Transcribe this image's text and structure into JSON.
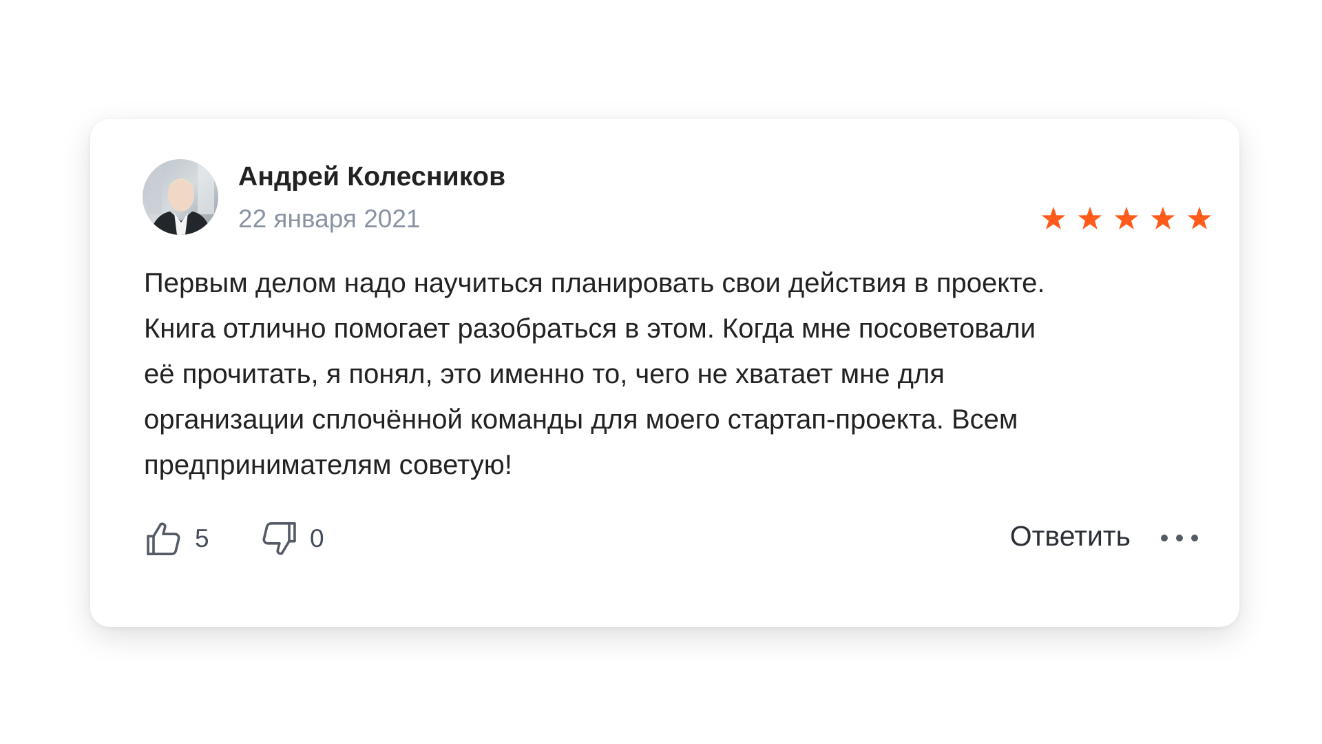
{
  "review": {
    "author": "Андрей Колесников",
    "date": "22 января 2021",
    "rating": 5,
    "rating_max": 5,
    "star_color": "#ff5b1a",
    "text_lines": [
      "Первым делом надо научиться планировать свои действия в проекте.",
      "Книга отлично помогает разобраться в этом. Когда мне посоветовали",
      "её прочитать, я понял, это именно то, чего не хватает мне для",
      "организации сплочённой команды для моего стартап-проекта. Всем",
      "предпринимателям советую!"
    ]
  },
  "actions": {
    "likes": "5",
    "dislikes": "0",
    "reply_label": "Ответить",
    "more_icon": "more-horizontal-icon"
  }
}
